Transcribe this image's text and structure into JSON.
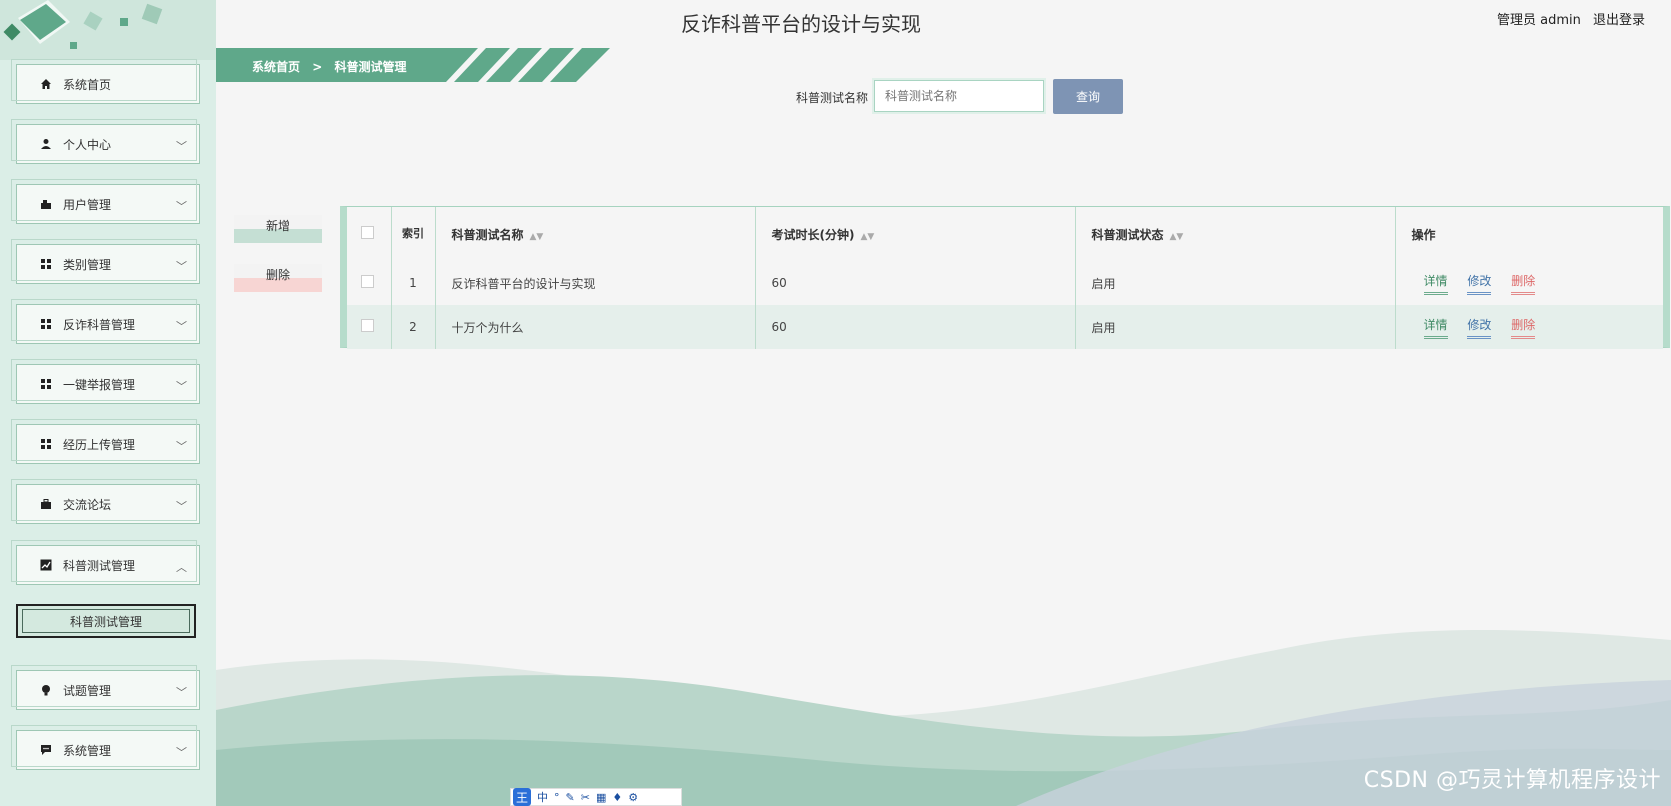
{
  "header": {
    "title": "反诈科普平台的设计与实现",
    "user_label": "管理员 admin",
    "logout_label": "退出登录"
  },
  "breadcrumb": {
    "home": "系统首页",
    "separator": ">",
    "current": "科普测试管理"
  },
  "sidebar": {
    "items": [
      {
        "label": "系统首页",
        "icon": "home-icon"
      },
      {
        "label": "个人中心",
        "icon": "user-icon"
      },
      {
        "label": "用户管理",
        "icon": "users-icon"
      },
      {
        "label": "类别管理",
        "icon": "grid-icon"
      },
      {
        "label": "反诈科普管理",
        "icon": "grid-icon"
      },
      {
        "label": "一键举报管理",
        "icon": "grid-icon"
      },
      {
        "label": "经历上传管理",
        "icon": "grid-icon"
      },
      {
        "label": "交流论坛",
        "icon": "briefcase-icon"
      },
      {
        "label": "科普测试管理",
        "icon": "chart-icon"
      },
      {
        "label": "试题管理",
        "icon": "bulb-icon"
      },
      {
        "label": "系统管理",
        "icon": "message-icon"
      }
    ],
    "submenu_active": "科普测试管理"
  },
  "search": {
    "label": "科普测试名称",
    "placeholder": "科普测试名称",
    "button": "查询"
  },
  "actions": {
    "add": "新增",
    "delete": "删除"
  },
  "table": {
    "headers": {
      "index": "索引",
      "name": "科普测试名称",
      "duration": "考试时长(分钟)",
      "status": "科普测试状态",
      "ops": "操作"
    },
    "rows": [
      {
        "index": "1",
        "name": "反诈科普平台的设计与实现",
        "duration": "60",
        "status": "启用"
      },
      {
        "index": "2",
        "name": "十万个为什么",
        "duration": "60",
        "status": "启用"
      }
    ],
    "op_labels": {
      "detail": "详情",
      "edit": "修改",
      "delete": "删除"
    }
  },
  "watermark": "CSDN @巧灵计算机程序设计",
  "ime": {
    "logo": "王",
    "mode": "中"
  },
  "colors": {
    "accent": "#5fa88a",
    "sidebar_bg": "#dbeee7",
    "search_button": "#7e94b4"
  }
}
